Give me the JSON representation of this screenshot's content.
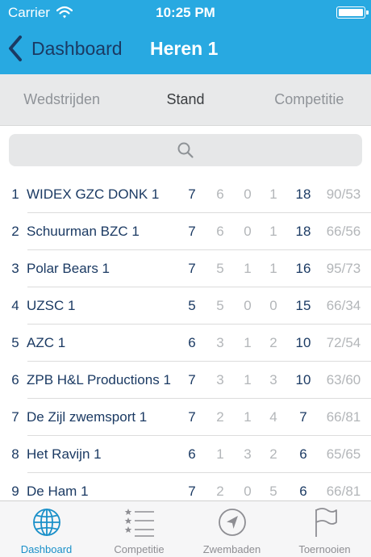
{
  "status_bar": {
    "carrier": "Carrier",
    "time": "10:25 PM"
  },
  "nav": {
    "back_label": "Dashboard",
    "title": "Heren 1"
  },
  "segments": [
    {
      "label": "Wedstrijden",
      "active": false
    },
    {
      "label": "Stand",
      "active": true
    },
    {
      "label": "Competitie",
      "active": false
    }
  ],
  "search": {
    "icon": "search-icon"
  },
  "standings": [
    {
      "rank": "1",
      "team": "WIDEX GZC DONK 1",
      "played": "7",
      "won": "6",
      "draw": "0",
      "lost": "1",
      "points": "18",
      "goals": "90/53"
    },
    {
      "rank": "2",
      "team": "Schuurman BZC 1",
      "played": "7",
      "won": "6",
      "draw": "0",
      "lost": "1",
      "points": "18",
      "goals": "66/56"
    },
    {
      "rank": "3",
      "team": "Polar Bears 1",
      "played": "7",
      "won": "5",
      "draw": "1",
      "lost": "1",
      "points": "16",
      "goals": "95/73"
    },
    {
      "rank": "4",
      "team": "UZSC 1",
      "played": "5",
      "won": "5",
      "draw": "0",
      "lost": "0",
      "points": "15",
      "goals": "66/34"
    },
    {
      "rank": "5",
      "team": "AZC 1",
      "played": "6",
      "won": "3",
      "draw": "1",
      "lost": "2",
      "points": "10",
      "goals": "72/54"
    },
    {
      "rank": "6",
      "team": "ZPB H&L Productions 1",
      "played": "7",
      "won": "3",
      "draw": "1",
      "lost": "3",
      "points": "10",
      "goals": "63/60"
    },
    {
      "rank": "7",
      "team": "De Zijl zwemsport 1",
      "played": "7",
      "won": "2",
      "draw": "1",
      "lost": "4",
      "points": "7",
      "goals": "66/81"
    },
    {
      "rank": "8",
      "team": "Het Ravijn 1",
      "played": "6",
      "won": "1",
      "draw": "3",
      "lost": "2",
      "points": "6",
      "goals": "65/65"
    },
    {
      "rank": "9",
      "team": "De Ham 1",
      "played": "7",
      "won": "2",
      "draw": "0",
      "lost": "5",
      "points": "6",
      "goals": "66/81"
    }
  ],
  "tabs": [
    {
      "label": "Dashboard",
      "icon": "globe-icon",
      "active": true
    },
    {
      "label": "Competitie",
      "icon": "ranked-list-icon",
      "active": false
    },
    {
      "label": "Zwembaden",
      "icon": "location-arrow-icon",
      "active": false
    },
    {
      "label": "Toernooien",
      "icon": "flag-icon",
      "active": false
    }
  ],
  "colors": {
    "accent": "#28a9e1",
    "nav_text": "#1b3a63",
    "tab_active": "#1a90c9",
    "muted": "#b3b6b9"
  }
}
